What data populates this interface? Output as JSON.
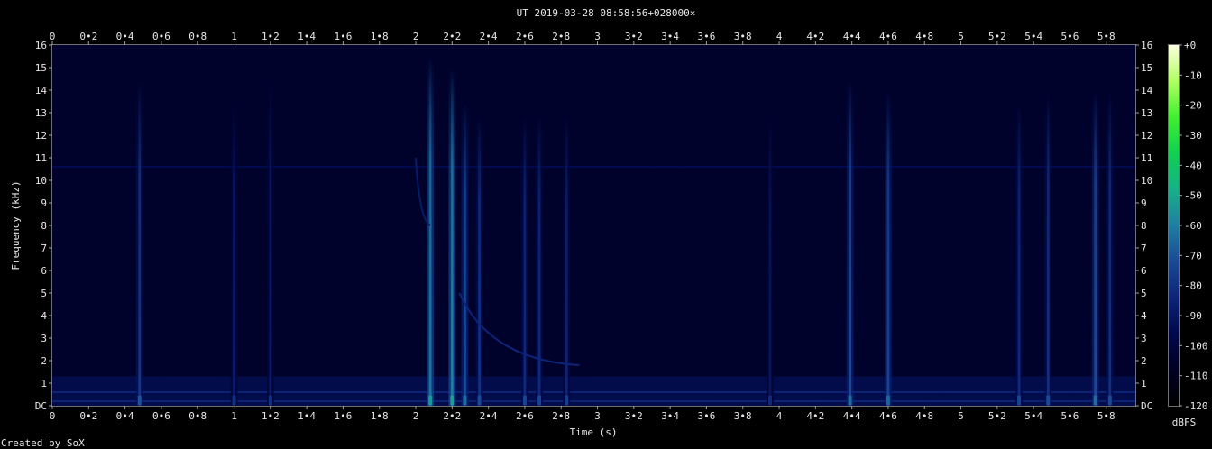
{
  "header": {
    "title": "UT 2019-03-28 08:58:56+028000×"
  },
  "footer": {
    "credit": "Created by SoX"
  },
  "colorbar": {
    "unit": "dBFS",
    "ticks": [
      "+0",
      "-10",
      "-20",
      "-30",
      "-40",
      "-50",
      "-60",
      "-70",
      "-80",
      "-90",
      "-100",
      "-110",
      "-120"
    ],
    "range": [
      -120,
      0
    ],
    "colors": [
      "#000000",
      "#000022",
      "#00084a",
      "#0d2478",
      "#1a4a96",
      "#1f7fa0",
      "#17b08a",
      "#10d050",
      "#40f030",
      "#b0ff60",
      "#ffffe0"
    ]
  },
  "chart_data": {
    "type": "heatmap",
    "title": "UT 2019-03-28 08:58:56+028000×",
    "xlabel": "Time (s)",
    "ylabel": "Frequency (kHz)",
    "xlim": [
      0,
      5.96
    ],
    "ylim": [
      0,
      16
    ],
    "x_ticks": [
      "0",
      "0•2",
      "0•4",
      "0•6",
      "0•8",
      "1",
      "1•2",
      "1•4",
      "1•6",
      "1•8",
      "2",
      "2•2",
      "2•4",
      "2•6",
      "2•8",
      "3",
      "3•2",
      "3•4",
      "3•6",
      "3•8",
      "4",
      "4•2",
      "4•4",
      "4•6",
      "4•8",
      "5",
      "5•2",
      "5•4",
      "5•6",
      "5•8"
    ],
    "y_ticks": [
      "DC",
      "1",
      "2",
      "3",
      "4",
      "5",
      "6",
      "7",
      "8",
      "9",
      "10",
      "11",
      "12",
      "13",
      "14",
      "15",
      "16"
    ],
    "background_level_dbfs": -105,
    "horizontal_lines": [
      {
        "freq_khz": 10.6,
        "level_dbfs": -95
      },
      {
        "freq_khz": 0.6,
        "level_dbfs": -85
      },
      {
        "freq_khz": 0.2,
        "level_dbfs": -85
      }
    ],
    "vertical_events": [
      {
        "t": 0.48,
        "fmax": 14.5,
        "level_dbfs": -78
      },
      {
        "t": 1.0,
        "fmax": 13.5,
        "level_dbfs": -88
      },
      {
        "t": 1.2,
        "fmax": 14.5,
        "level_dbfs": -88
      },
      {
        "t": 2.08,
        "fmax": 15.5,
        "level_dbfs": -62
      },
      {
        "t": 2.2,
        "fmax": 15.0,
        "level_dbfs": -60
      },
      {
        "t": 2.27,
        "fmax": 13.5,
        "level_dbfs": -72
      },
      {
        "t": 2.35,
        "fmax": 13.0,
        "level_dbfs": -80
      },
      {
        "t": 2.6,
        "fmax": 13.0,
        "level_dbfs": -82
      },
      {
        "t": 2.68,
        "fmax": 13.0,
        "level_dbfs": -82
      },
      {
        "t": 2.83,
        "fmax": 13.0,
        "level_dbfs": -84
      },
      {
        "t": 3.95,
        "fmax": 13.0,
        "level_dbfs": -90
      },
      {
        "t": 4.39,
        "fmax": 14.5,
        "level_dbfs": -72
      },
      {
        "t": 4.6,
        "fmax": 14.0,
        "level_dbfs": -74
      },
      {
        "t": 5.32,
        "fmax": 13.5,
        "level_dbfs": -82
      },
      {
        "t": 5.48,
        "fmax": 14.0,
        "level_dbfs": -80
      },
      {
        "t": 5.74,
        "fmax": 14.0,
        "level_dbfs": -72
      },
      {
        "t": 5.82,
        "fmax": 14.0,
        "level_dbfs": -80
      }
    ],
    "sweeps": [
      {
        "t_start": 2.24,
        "f_start_khz": 5.0,
        "t_end": 2.9,
        "f_end_khz": 1.8,
        "level_dbfs": -84
      },
      {
        "t_start": 2.0,
        "f_start_khz": 11.0,
        "t_end": 2.08,
        "f_end_khz": 8.0,
        "level_dbfs": -88
      }
    ]
  }
}
